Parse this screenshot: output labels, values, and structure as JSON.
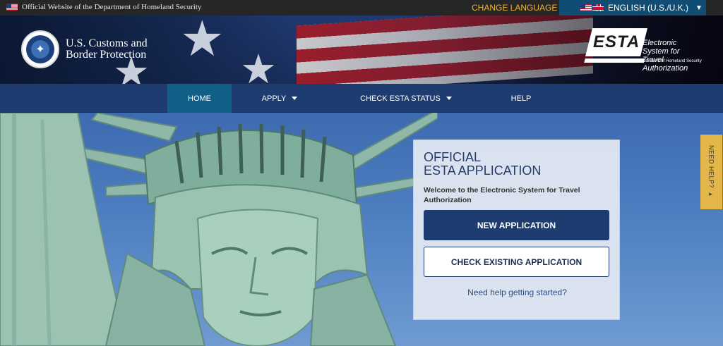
{
  "topbar": {
    "official_text": "Official Website of the Department of Homeland Security",
    "change_language": "CHANGE LANGUAGE",
    "language_selected": "ENGLISH (U.S./U.K.)"
  },
  "header": {
    "agency_line1": "U.S. Customs and",
    "agency_line2": "Border Protection",
    "esta_logo_text": "ESTA",
    "esta_tagline_line1": "Electronic System for",
    "esta_tagline_line2": "Travel Authorization",
    "esta_subline": "U.S. Department of Homeland Security"
  },
  "nav": {
    "items": [
      {
        "label": "HOME",
        "active": true
      },
      {
        "label": "APPLY",
        "dropdown": true
      },
      {
        "label": "CHECK ESTA STATUS",
        "dropdown": true
      },
      {
        "label": "HELP"
      }
    ]
  },
  "card": {
    "title_line1": "OFFICIAL",
    "title_line2": "ESTA APPLICATION",
    "welcome": "Welcome to the Electronic System for Travel Authorization",
    "new_application": "NEW APPLICATION",
    "check_existing": "CHECK EXISTING APPLICATION",
    "help_link": "Need help getting started?"
  },
  "side_tab": {
    "label": "NEED HELP?"
  },
  "colors": {
    "nav_bg": "#1e3c70",
    "nav_active": "#0f5f86",
    "accent_gold": "#f0b43a",
    "help_tab": "#e2b649"
  },
  "icons": [
    "us-flag-icon",
    "uk-flag-icon",
    "caret-right-icon",
    "chevron-down-icon",
    "dhs-seal-icon",
    "esta-logo-icon"
  ]
}
